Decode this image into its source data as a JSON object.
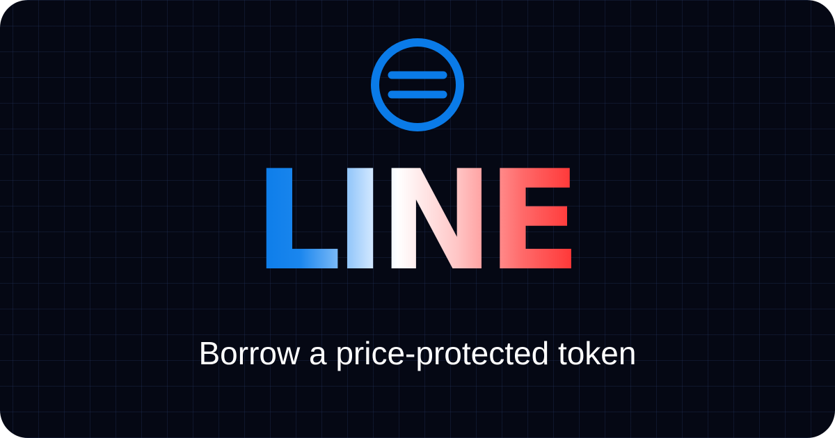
{
  "brand": {
    "name": "LINE",
    "tagline": "Borrow a price-protected token",
    "logo_icon": "circle-equals-icon"
  },
  "colors": {
    "background": "#050814",
    "accent_blue": "#0a7be8",
    "accent_red": "#ff2f2f",
    "text": "#ffffff"
  }
}
